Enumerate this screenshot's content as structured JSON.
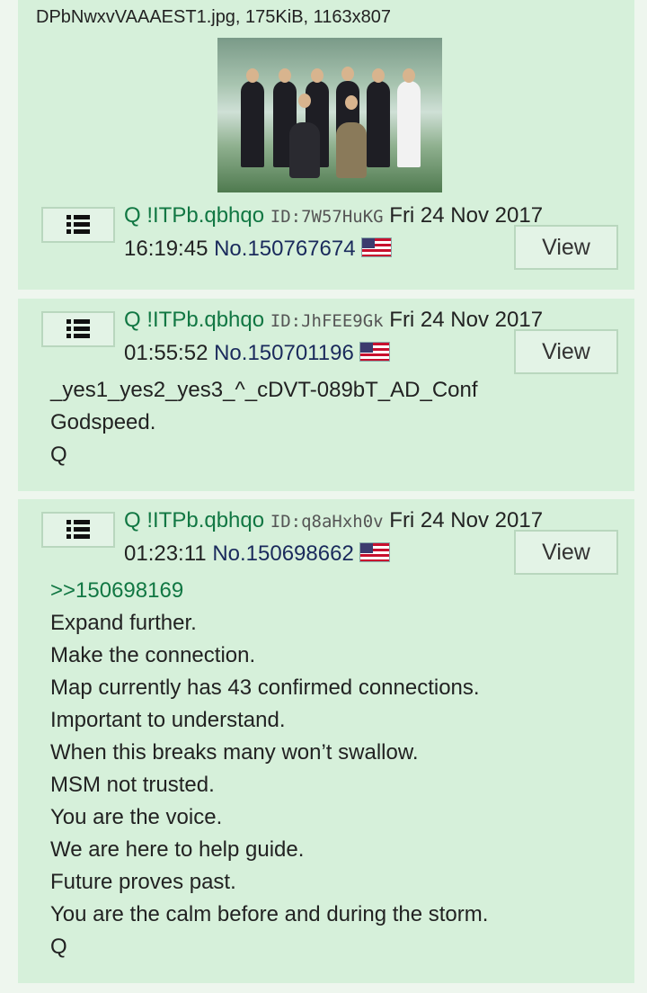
{
  "posts": [
    {
      "file_info": "DPbNwxvVAAAEST1.jpg, 175KiB, 1163x807",
      "name": "Q !ITPb.qbhqo",
      "id": "ID:7W57HuKG",
      "date": "Fri 24 Nov 2017",
      "time": "16:19:45",
      "number": "No.150767674",
      "view_label": "View"
    },
    {
      "name": "Q !ITPb.qbhqo",
      "id": "ID:JhFEE9Gk",
      "date": "Fri 24 Nov 2017",
      "time": "01:55:52",
      "number": "No.150701196",
      "view_label": "View",
      "lines": [
        "_yes1_yes2_yes3_^_cDVT-089bT_AD_Conf",
        "Godspeed.",
        "Q"
      ]
    },
    {
      "name": "Q !ITPb.qbhqo",
      "id": "ID:q8aHxh0v",
      "date": "Fri 24 Nov 2017",
      "time": "01:23:11",
      "number": "No.150698662",
      "view_label": "View",
      "quote_link": ">>150698169",
      "lines": [
        "Expand further.",
        "Make the connection.",
        "Map currently has 43 confirmed connections.",
        "Important to understand.",
        "When this breaks many won’t swallow.",
        "MSM not trusted.",
        "You are the voice.",
        "We are here to help guide.",
        "Future proves past.",
        "You are the calm before and during the storm.",
        "Q"
      ]
    }
  ],
  "icons": {
    "menu": "list-menu-icon",
    "flag": "us-flag-icon"
  }
}
